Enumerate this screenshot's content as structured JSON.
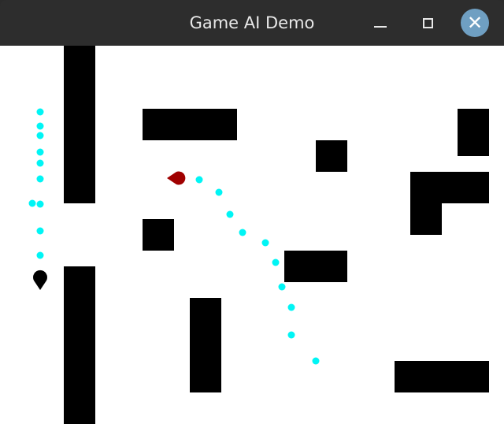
{
  "window": {
    "title": "Game AI Demo",
    "controls": {
      "minimize": "minimize",
      "maximize": "maximize",
      "close": "close"
    }
  },
  "scene": {
    "background": "#ffffff",
    "obstacle_color": "#000000",
    "path_color": "#00ffff",
    "agents": [
      {
        "name": "player-agent",
        "color": "#000000",
        "shape": "map-pin"
      },
      {
        "name": "chaser-agent",
        "color": "#a00000",
        "shape": "teardrop"
      }
    ]
  }
}
